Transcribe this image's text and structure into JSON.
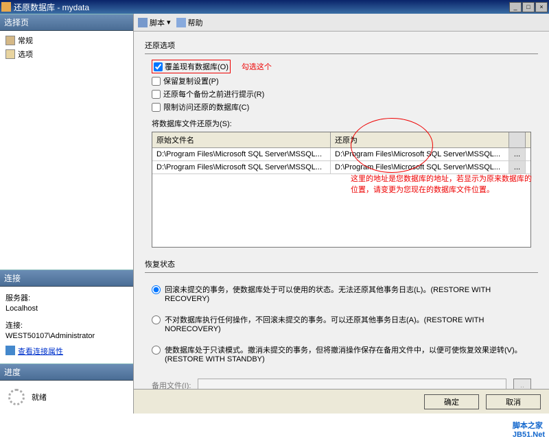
{
  "title": "还原数据库 - mydata",
  "sidebar": {
    "select_page": "选择页",
    "nav": [
      "常规",
      "选项"
    ],
    "connection": {
      "header": "连接",
      "server_label": "服务器:",
      "server_value": "Localhost",
      "conn_label": "连接:",
      "conn_value": "WEST50107\\Administrator",
      "view_props": "查看连接属性"
    },
    "progress": {
      "header": "进度",
      "status": "就绪"
    }
  },
  "toolbar": {
    "script": "脚本",
    "help": "帮助"
  },
  "restore_options": {
    "header": "还原选项",
    "overwrite": "覆盖现有数据库(O)",
    "preserve": "保留复制设置(P)",
    "prompt": "还原每个备份之前进行提示(R)",
    "restrict": "限制访问还原的数据库(C)",
    "note1": "勾选这个",
    "files_label": "将数据库文件还原为(S):",
    "col_orig": "原始文件名",
    "col_restore": "还原为",
    "rows": [
      {
        "orig": "D:\\Program Files\\Microsoft SQL Server\\MSSQL...",
        "restore": "D:\\Program Files\\Microsoft SQL Server\\MSSQL..."
      },
      {
        "orig": "D:\\Program Files\\Microsoft SQL Server\\MSSQL...",
        "restore": "D:\\Program Files\\Microsoft SQL Server\\MSSQL..."
      }
    ],
    "note2a": "这里的地址是您数据库的地址，若显示为原来数据库的",
    "note2b": "位置，请变更为您现在的数据库文件位置。"
  },
  "recovery": {
    "header": "恢复状态",
    "opt1": "回滚未提交的事务，使数据库处于可以使用的状态。无法还原其他事务日志(L)。(RESTORE WITH RECOVERY)",
    "opt2": "不对数据库执行任何操作，不回滚未提交的事务。可以还原其他事务日志(A)。(RESTORE WITH NORECOVERY)",
    "opt3": "使数据库处于只读模式。撤消未提交的事务，但将撤消操作保存在备用文件中，以便可使恢复效果逆转(V)。(RESTORE WITH STANDBY)",
    "backup_file": "备用文件(I):"
  },
  "footer": {
    "ok": "确定",
    "cancel": "取消"
  },
  "watermark": {
    "line1": "脚本之家",
    "line2": "JB51.Net"
  }
}
